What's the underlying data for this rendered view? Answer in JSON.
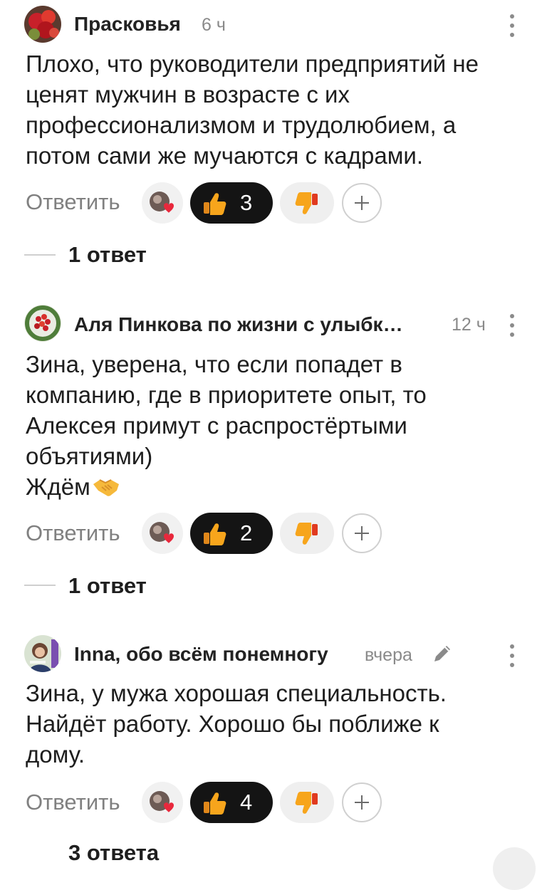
{
  "comments": [
    {
      "author": "Прасковья",
      "time": "6 ч",
      "text": "Плохо, что руководители предприятий не\nценят мужчин в возрасте с их\nпрофессионализмом и трудолюбием, а\nпотом сами же мучаются с кадрами.",
      "reply_label": "Ответить",
      "likes": "3",
      "replies": "1 ответ"
    },
    {
      "author": "Аля Пинкова по жизни с улыбк…",
      "time": "12 ч",
      "text": "Зина, уверена, что если попадет в\nкомпанию, где в приоритете опыт, то\nАлексея примут с распростёртыми\nобъятиями)",
      "text_last": "Ждём",
      "emoji": "handshake-emoji",
      "reply_label": "Ответить",
      "likes": "2",
      "replies": "1 ответ"
    },
    {
      "author": "Inna, обо всём понемногу",
      "time": "вчера",
      "text": "Зина, у мужа хорошая специальность.\nНайдёт работу. Хорошо бы поближе к\nдому.",
      "reply_label": "Ответить",
      "likes": "4",
      "replies": "3 ответа"
    }
  ],
  "icons": {
    "like": "thumbs-up-icon",
    "dislike": "thumbs-down-icon",
    "add": "plus-icon",
    "more": "more-vertical-icon",
    "edit": "pencil-icon"
  },
  "colors": {
    "accent_dark": "#141414",
    "thumb": "#f7a51c",
    "heart": "#e8283c"
  }
}
